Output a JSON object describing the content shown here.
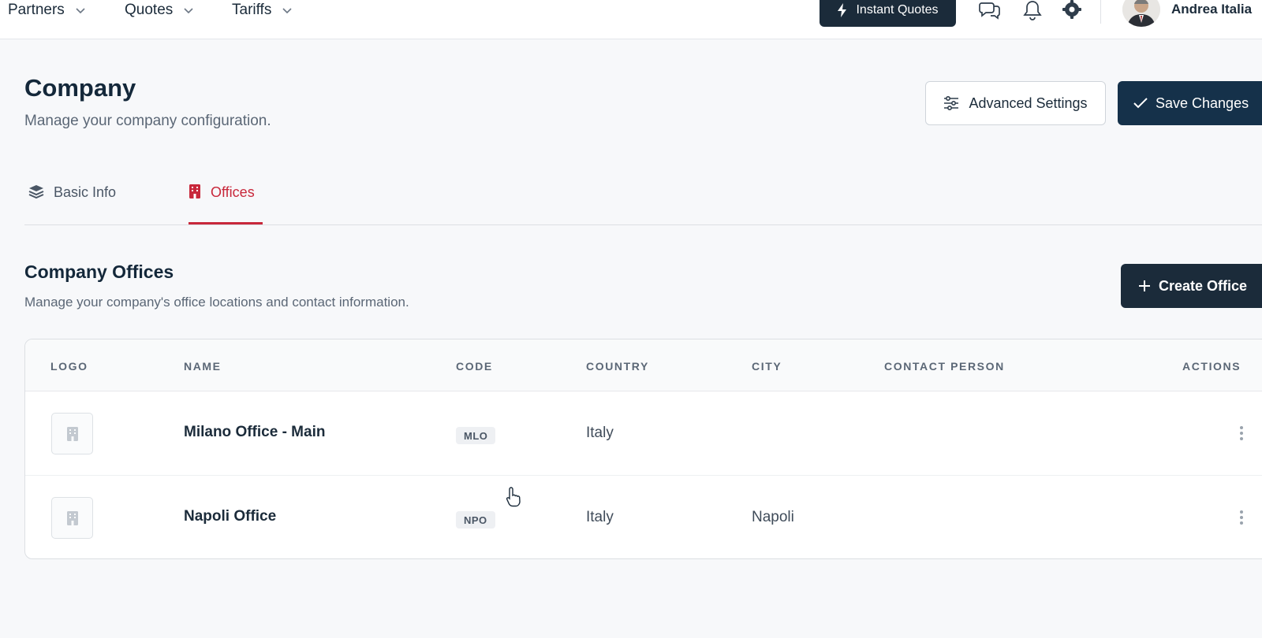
{
  "nav": {
    "items": [
      {
        "label": "Partners"
      },
      {
        "label": "Quotes"
      },
      {
        "label": "Tariffs"
      }
    ],
    "instant_quotes_label": "Instant Quotes",
    "icons": [
      "chat-bubbles-icon",
      "bell-icon",
      "gear-icon"
    ],
    "user_name": "Andrea Italia"
  },
  "header": {
    "title": "Company",
    "subtitle": "Manage your company configuration.",
    "advanced_settings_label": "Advanced Settings",
    "save_changes_label": "Save Changes"
  },
  "tabs": [
    {
      "label": "Basic Info",
      "icon": "layers-icon",
      "active": false
    },
    {
      "label": "Offices",
      "icon": "building-icon",
      "active": true
    }
  ],
  "offices_section": {
    "title": "Company Offices",
    "subtitle": "Manage your company's office locations and contact information.",
    "create_label": "Create Office"
  },
  "table": {
    "columns": [
      "LOGO",
      "NAME",
      "CODE",
      "COUNTRY",
      "CITY",
      "CONTACT PERSON",
      "ACTIONS"
    ],
    "rows": [
      {
        "name": "Milano Office - Main",
        "code": "MLO",
        "country": "Italy",
        "city": "",
        "contact": ""
      },
      {
        "name": "Napoli Office",
        "code": "NPO",
        "country": "Italy",
        "city": "Napoli",
        "contact": ""
      }
    ]
  },
  "colors": {
    "primary": "#1b2b3a",
    "accent_red": "#c8283b",
    "muted": "#5b6776",
    "background": "#f7f8fa"
  }
}
